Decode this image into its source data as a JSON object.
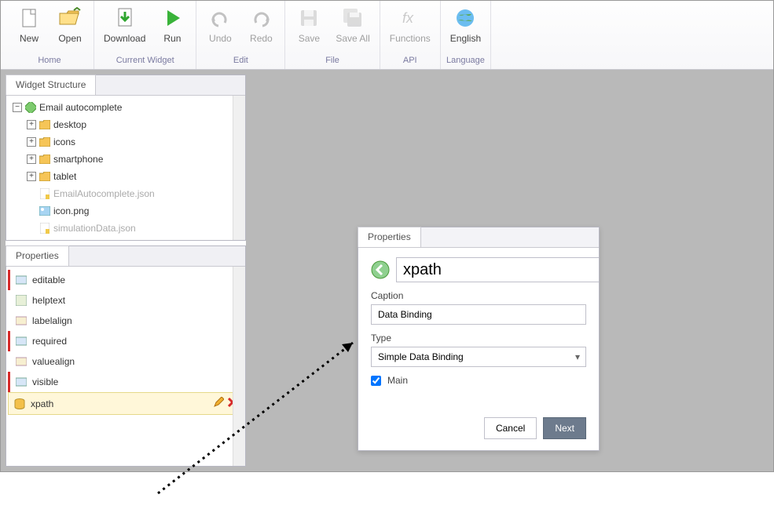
{
  "ribbon": {
    "groups": [
      {
        "label": "Home",
        "items": [
          {
            "key": "new",
            "label": "New"
          },
          {
            "key": "open",
            "label": "Open"
          }
        ]
      },
      {
        "label": "Current Widget",
        "items": [
          {
            "key": "download",
            "label": "Download"
          },
          {
            "key": "run",
            "label": "Run"
          }
        ]
      },
      {
        "label": "Edit",
        "items": [
          {
            "key": "undo",
            "label": "Undo",
            "disabled": true
          },
          {
            "key": "redo",
            "label": "Redo",
            "disabled": true
          }
        ]
      },
      {
        "label": "File",
        "items": [
          {
            "key": "save",
            "label": "Save",
            "disabled": true
          },
          {
            "key": "saveall",
            "label": "Save All",
            "disabled": true
          }
        ]
      },
      {
        "label": "API",
        "items": [
          {
            "key": "functions",
            "label": "Functions",
            "disabled": true
          }
        ]
      },
      {
        "label": "Language",
        "items": [
          {
            "key": "english",
            "label": "English"
          }
        ]
      }
    ]
  },
  "structure": {
    "tab": "Widget Structure",
    "root": "Email autocomplete",
    "folders": [
      "desktop",
      "icons",
      "smartphone",
      "tablet"
    ],
    "files": [
      {
        "name": "EmailAutocomplete.json",
        "dim": true
      },
      {
        "name": "icon.png",
        "dim": false
      },
      {
        "name": "simulationData.json",
        "dim": true
      }
    ]
  },
  "props": {
    "tab": "Properties",
    "items": [
      {
        "name": "editable",
        "required": true
      },
      {
        "name": "helptext",
        "required": false
      },
      {
        "name": "labelalign",
        "required": false
      },
      {
        "name": "required",
        "required": true
      },
      {
        "name": "valuealign",
        "required": false
      },
      {
        "name": "visible",
        "required": true
      },
      {
        "name": "xpath",
        "required": true,
        "selected": true
      }
    ]
  },
  "dialog": {
    "tab": "Properties",
    "search_value": "xpath",
    "caption_label": "Caption",
    "caption_value": "Data Binding",
    "type_label": "Type",
    "type_value": "Simple Data Binding",
    "main_label": "Main",
    "main_checked": true,
    "cancel": "Cancel",
    "next": "Next"
  }
}
